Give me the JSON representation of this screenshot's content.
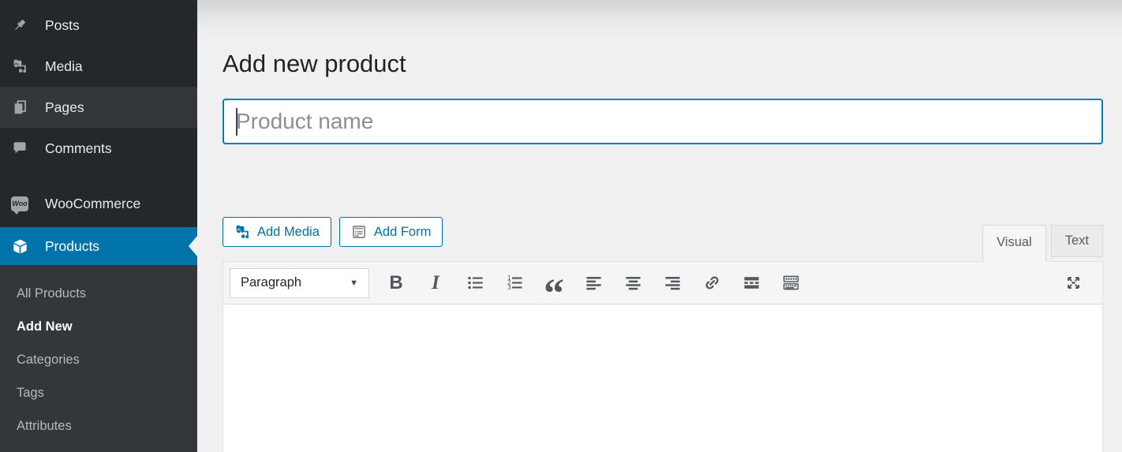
{
  "sidebar": {
    "items": [
      {
        "label": "Posts",
        "icon": "pushpin-icon"
      },
      {
        "label": "Media",
        "icon": "media-icon"
      },
      {
        "label": "Pages",
        "icon": "pages-icon"
      },
      {
        "label": "Comments",
        "icon": "comments-icon"
      },
      {
        "label": "WooCommerce",
        "icon": "woocommerce-icon"
      },
      {
        "label": "Products",
        "icon": "products-box-icon",
        "active": true
      }
    ],
    "woo_badge": "Woo",
    "submenu": [
      {
        "label": "All Products"
      },
      {
        "label": "Add New",
        "current": true
      },
      {
        "label": "Categories"
      },
      {
        "label": "Tags"
      },
      {
        "label": "Attributes"
      }
    ]
  },
  "page": {
    "title": "Add new product"
  },
  "title_input": {
    "value": "",
    "placeholder": "Product name"
  },
  "media_buttons": [
    {
      "label": "Add Media",
      "icon": "media-icon"
    },
    {
      "label": "Add Form",
      "icon": "form-icon"
    }
  ],
  "editor": {
    "tabs": [
      {
        "label": "Visual",
        "active": true
      },
      {
        "label": "Text",
        "active": false
      }
    ],
    "toolbar": {
      "format_select": {
        "value": "Paragraph"
      },
      "buttons": [
        "bold",
        "italic",
        "bulleted-list",
        "numbered-list",
        "blockquote",
        "align-left",
        "align-center",
        "align-right",
        "insert-link",
        "insert-more-tag",
        "toolbar-toggle",
        "distraction-free-fullscreen"
      ]
    },
    "content": ""
  },
  "icons": {
    "bold_glyph": "B",
    "italic_glyph": "I",
    "blockquote_glyph": "“",
    "select_arrow_glyph": "▼",
    "digit_1": "1",
    "digit_2": "2",
    "digit_3": "3"
  },
  "colors": {
    "accent_blue": "#0073aa",
    "focus_blue": "#007cba",
    "button_blue": "#0071a1",
    "sidebar_bg": "#23282d",
    "submenu_bg": "#32373c",
    "page_bg": "#f0f0f1",
    "toolbar_bg": "#f5f5f5"
  }
}
